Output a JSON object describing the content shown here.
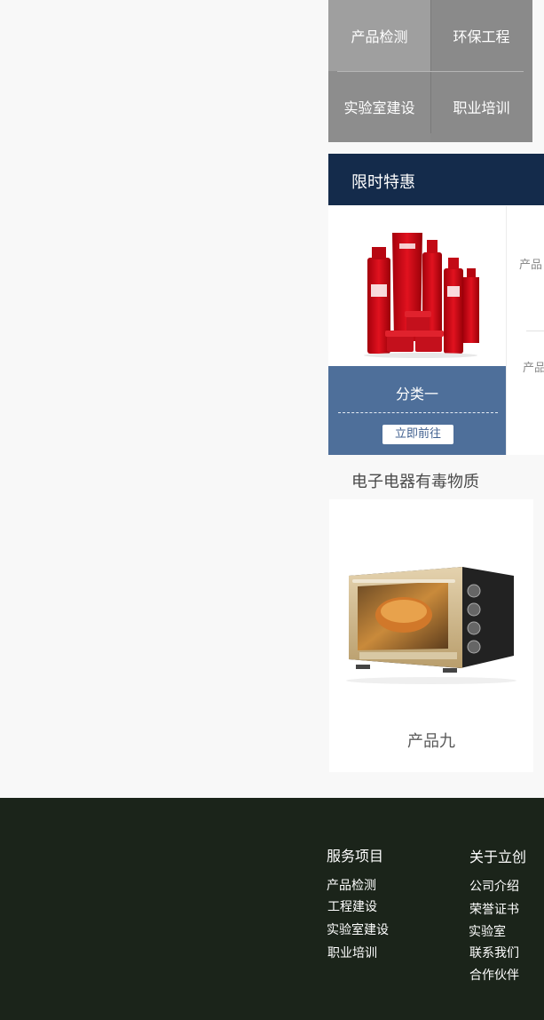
{
  "services": {
    "items": [
      "产品检测",
      "环保工程",
      "实验室建设",
      "职业培训"
    ]
  },
  "promo": {
    "title": "限时特惠",
    "card": {
      "category": "分类一",
      "button_label": "立即前往",
      "image_icon": "cosmetics-product-image"
    },
    "side_items": [
      "产品",
      "产品"
    ]
  },
  "toxins": {
    "title": "电子电器有毒物质",
    "product": {
      "caption": "产品九",
      "image_icon": "oven-product-image"
    }
  },
  "footer": {
    "services_heading": "服务项目",
    "services_links": [
      "产品检测",
      "工程建设",
      "实验室建设",
      "职业培训"
    ],
    "about_heading": "关于立创",
    "about_links": [
      "公司介绍",
      "荣誉证书",
      "实验室",
      "联系我们",
      "合作伙伴"
    ]
  },
  "colors": {
    "page_bg": "#f8f8f8",
    "service_grid": "#8c8c8c",
    "promo_header": "#142b4b",
    "promo_panel": "#4e6f9a",
    "footer_bg": "#1b241a"
  }
}
